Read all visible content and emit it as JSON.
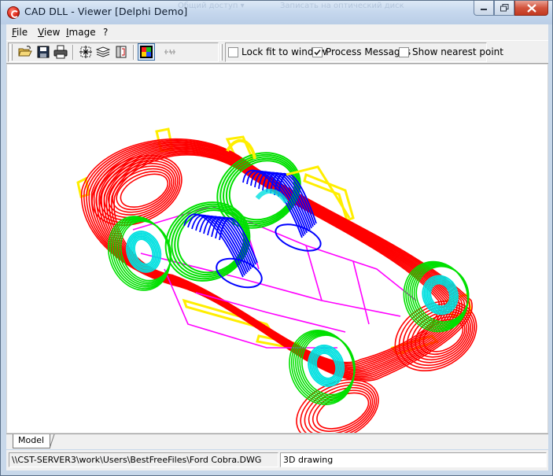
{
  "window": {
    "title": "CAD DLL - Viewer [Delphi Demo]",
    "ghost_tabs": [
      "Общий доступ ▾",
      "Записать на оптический диск"
    ]
  },
  "menu": {
    "items": [
      {
        "label": "File",
        "accel": "F",
        "rest": "ile"
      },
      {
        "label": "View",
        "accel": "V",
        "rest": "iew"
      },
      {
        "label": "Image",
        "accel": "I",
        "rest": "mage"
      },
      {
        "label": "?",
        "accel": "",
        "rest": "?"
      }
    ]
  },
  "toolbar": {
    "buttons": [
      "open-icon",
      "save-icon",
      "print-icon",
      "fit-icon",
      "layers-icon",
      "crop-icon",
      "color-icon",
      "measure-icon"
    ],
    "lock_fit": {
      "label": "Lock fit to window",
      "checked": false
    },
    "process_messages": {
      "label": "Process Messages",
      "checked": true
    },
    "show_nearest": {
      "label": "Show nearest point",
      "checked": false
    }
  },
  "tabs": {
    "model": "Model"
  },
  "status": {
    "file_path": "\\\\CST-SERVER3\\work\\Users\\BestFreeFiles\\Ford Cobra.DWG",
    "mode": "3D drawing"
  },
  "colors": {
    "body": "#ff0000",
    "wheel": "#00e000",
    "hub": "#00e0e0",
    "seat": "#0000ff",
    "frame": "#ff00ff",
    "trim": "#ffee00"
  }
}
